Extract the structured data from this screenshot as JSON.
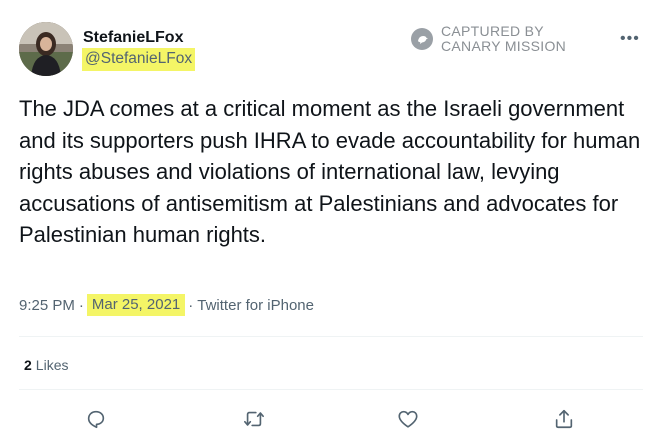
{
  "tweet": {
    "author_name": "StefanieLFox",
    "author_handle": "@StefanieLFox",
    "captured_line1": "CAPTURED BY",
    "captured_line2": "CANARY MISSION",
    "more_label": "•••",
    "text": "The JDA comes at a critical moment as the Israeli government and its supporters push IHRA to evade accountability for human rights abuses and violations of international law, levying accusations of antisemitism at Palestinians and advocates for Palestinian human rights.",
    "time": "9:25 PM",
    "separator": "·",
    "date": "Mar 25, 2021",
    "source": "Twitter for iPhone",
    "likes_count": "2",
    "likes_label": "Likes"
  },
  "actions": {
    "icons": [
      "reply-icon",
      "retweet-icon",
      "like-icon",
      "share-icon"
    ]
  },
  "colors": {
    "highlight": "#f4f566",
    "secondary_text": "#536471",
    "primary_text": "#0f1419",
    "divider": "#eff3f4"
  }
}
